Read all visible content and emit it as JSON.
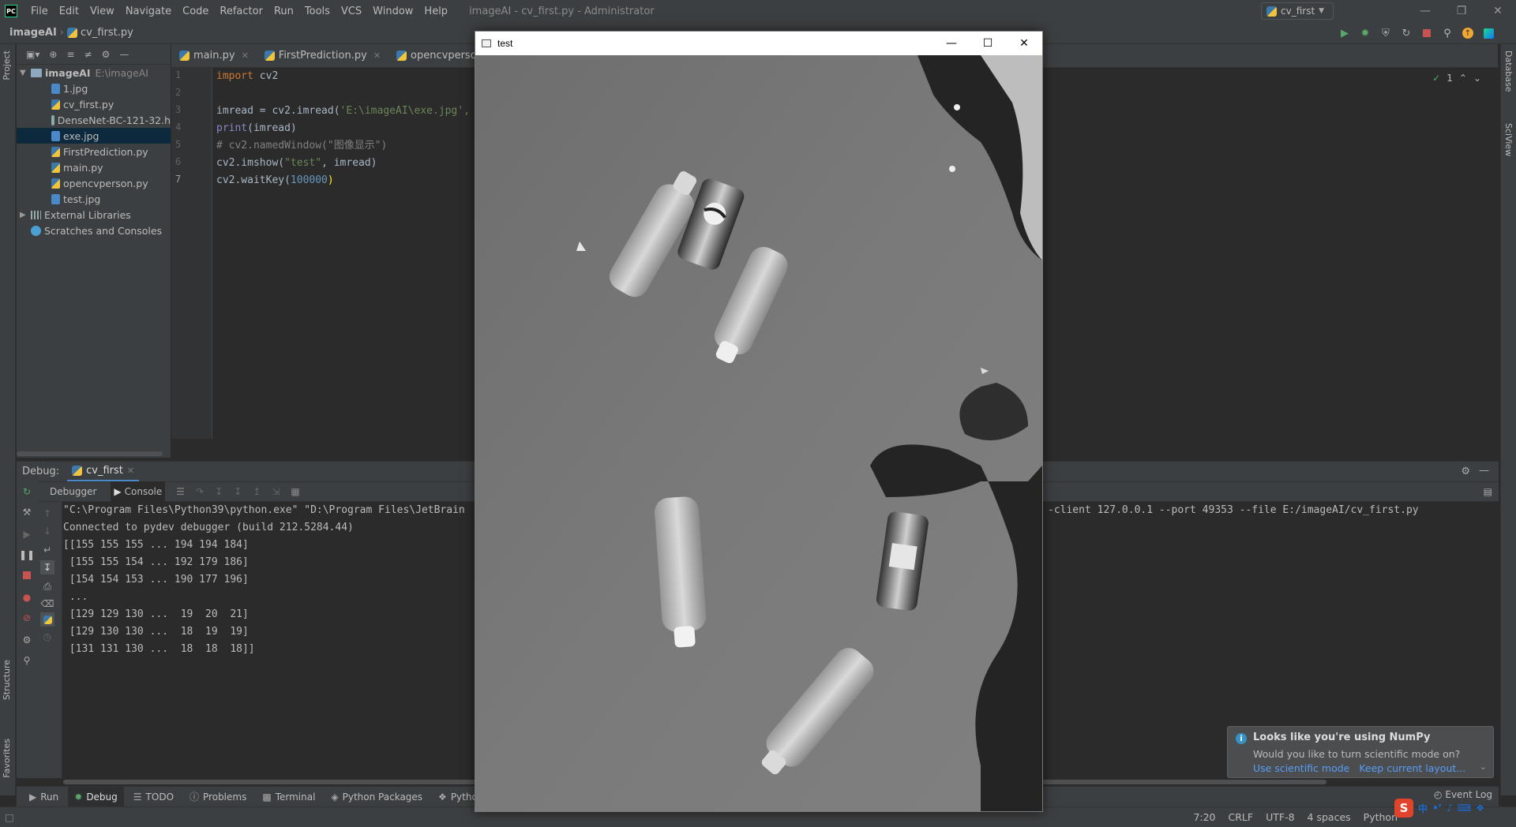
{
  "app": {
    "window_title": "imageAI - cv_first.py - Administrator",
    "menu": [
      "File",
      "Edit",
      "View",
      "Navigate",
      "Code",
      "Refactor",
      "Run",
      "Tools",
      "VCS",
      "Window",
      "Help"
    ]
  },
  "navbar": {
    "project": "imageAI",
    "file": "cv_first.py",
    "run_config": "cv_first"
  },
  "left_strip": {
    "project": "Project",
    "structure": "Structure",
    "favorites": "Favorites"
  },
  "right_strip": {
    "database": "Database",
    "sciview": "SciView"
  },
  "project_tree": {
    "root": {
      "name": "imageAI",
      "path": "E:\\imageAI"
    },
    "files": [
      "1.jpg",
      "cv_first.py",
      "DenseNet-BC-121-32.h",
      "exe.jpg",
      "FirstPrediction.py",
      "main.py",
      "opencvperson.py",
      "test.jpg"
    ],
    "external_libraries": "External Libraries",
    "scratches": "Scratches and Consoles"
  },
  "editor_tabs": [
    "main.py",
    "FirstPrediction.py",
    "opencvperson.py"
  ],
  "editor": {
    "line_numbers": [
      "1",
      "2",
      "3",
      "4",
      "5",
      "6",
      "7"
    ],
    "line1_kw": "import",
    "line1_rest": " cv2",
    "line3_a": "imread = cv2.imread(",
    "line3_str": "'E:\\imageAI\\exe.jpg',",
    "line4_fn": "print",
    "line4_rest": "(imread)",
    "line5": "# cv2.namedWindow(\"图像显示\")",
    "line6_a": "cv2.imshow(",
    "line6_str": "\"test\"",
    "line6_b": ", imread)",
    "line7_a": "cv2.waitKey(",
    "line7_num": "100000",
    "line7_b": ")",
    "inspection_count": "1"
  },
  "debug": {
    "label": "Debug:",
    "tab": "cv_first",
    "subtabs": {
      "debugger": "Debugger",
      "console": "Console"
    }
  },
  "console": {
    "lines": [
      "\"C:\\Program Files\\Python39\\python.exe\" \"D:\\Program Files\\JetBrain",
      "Connected to pydev debugger (build 212.5284.44)",
      "[[155 155 155 ... 194 194 184]",
      " [155 155 154 ... 192 179 186]",
      " [154 154 153 ... 190 177 196]",
      " ...",
      " [129 129 130 ...  19  20  21]",
      " [129 130 130 ...  18  19  19]",
      " [131 131 130 ...  18  18  18]]"
    ],
    "line0_tail": "-client 127.0.0.1 --port 49353 --file E:/imageAI/cv_first.py"
  },
  "notification": {
    "title": "Looks like you're using NumPy",
    "body": "Would you like to turn scientific mode on?",
    "action_primary": "Use scientific mode",
    "action_secondary": "Keep current layout..."
  },
  "bottom_tools": [
    "Run",
    "Debug",
    "TODO",
    "Problems",
    "Terminal",
    "Python Packages",
    "Python Co"
  ],
  "event_log": "Event Log",
  "status": {
    "position": "7:20",
    "line_ending": "CRLF",
    "encoding": "UTF-8",
    "indent": "4 spaces",
    "interpreter": "Python"
  },
  "cv_window": {
    "title": "test"
  },
  "ime": {
    "logo": "S",
    "mode": "中"
  }
}
